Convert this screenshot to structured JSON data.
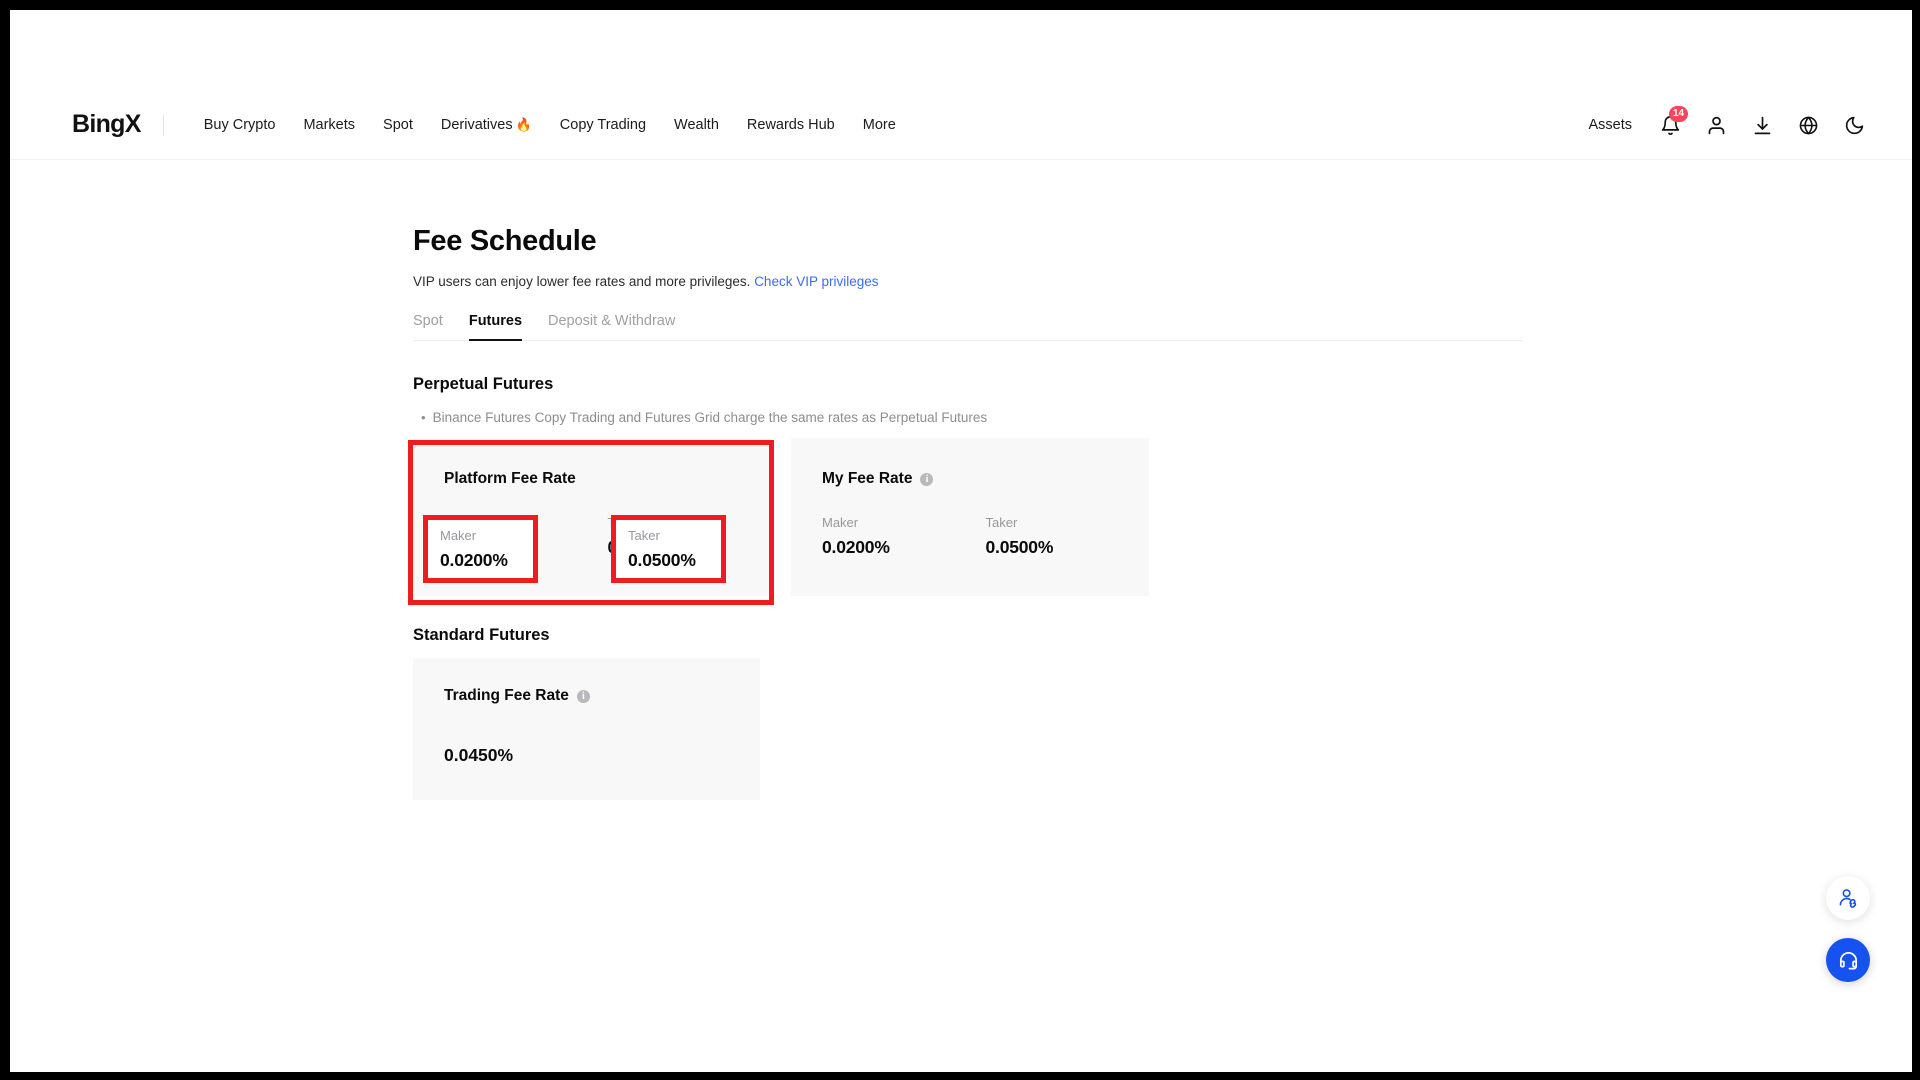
{
  "header": {
    "brand": "BingX",
    "nav": [
      {
        "label": "Buy Crypto",
        "icon": ""
      },
      {
        "label": "Markets",
        "icon": ""
      },
      {
        "label": "Spot",
        "icon": ""
      },
      {
        "label": "Derivatives",
        "icon": "🔥"
      },
      {
        "label": "Copy Trading",
        "icon": ""
      },
      {
        "label": "Wealth",
        "icon": ""
      },
      {
        "label": "Rewards Hub",
        "icon": ""
      },
      {
        "label": "More",
        "icon": ""
      }
    ],
    "assets_label": "Assets",
    "notification_count": "14",
    "icons": {
      "bell": "bell-icon",
      "profile": "user-icon",
      "download": "download-icon",
      "language": "globe-icon",
      "theme": "moon-icon"
    }
  },
  "page": {
    "title": "Fee Schedule",
    "subtitle_text": "VIP users can enjoy lower fee rates and more privileges.",
    "subtitle_link": "Check VIP privileges"
  },
  "tabs": [
    {
      "label": "Spot",
      "active": false
    },
    {
      "label": "Futures",
      "active": true
    },
    {
      "label": "Deposit & Withdraw",
      "active": false
    }
  ],
  "perpetual": {
    "section_title": "Perpetual Futures",
    "note": "Binance Futures Copy Trading and Futures Grid charge the same rates as Perpetual Futures",
    "bullet": "•",
    "platform_card": {
      "title": "Platform Fee Rate",
      "maker_label": "Maker",
      "maker_value": "0.0200%",
      "taker_label": "Taker",
      "taker_value": "0.0500%"
    },
    "my_card": {
      "title": "My Fee Rate",
      "info": "i",
      "maker_label": "Maker",
      "maker_value": "0.0200%",
      "taker_label": "Taker",
      "taker_value": "0.0500%"
    }
  },
  "standard": {
    "section_title": "Standard Futures",
    "card_title": "Trading Fee Rate",
    "info": "i",
    "value": "0.0450%"
  },
  "fabs": {
    "referral": "referral-icon",
    "support": "headset-icon"
  },
  "colors": {
    "accent_blue": "#1652f0",
    "link_blue": "#3c6df0",
    "badge_red": "#f6465d",
    "annotation_red": "#ee1c1c",
    "card_bg": "#f8f8f8"
  }
}
